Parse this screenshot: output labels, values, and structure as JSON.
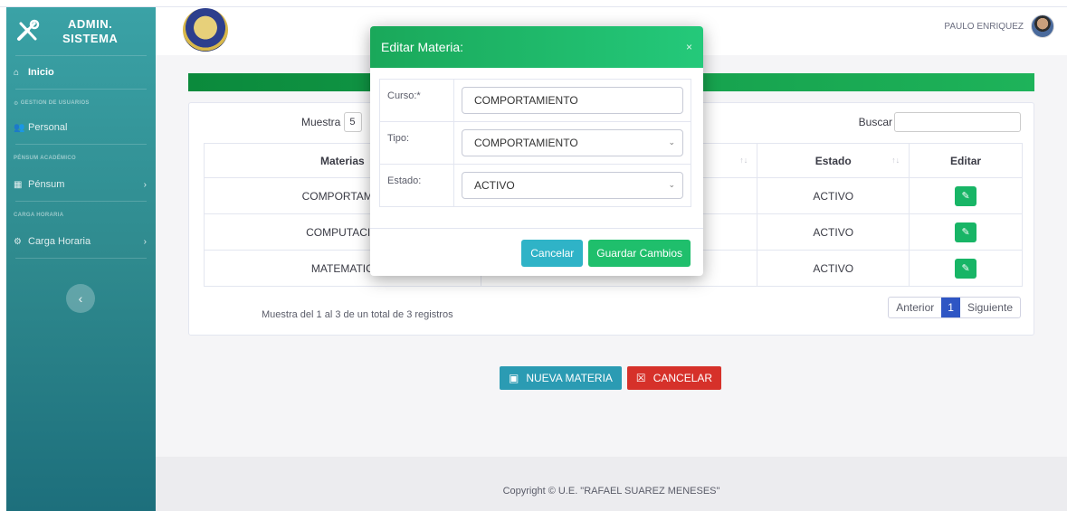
{
  "sidebar": {
    "brand_line1": "ADMIN.",
    "brand_line2": "SISTEMA",
    "brand_icon": "tools-icon",
    "inicio": "Inicio",
    "heading_users": "GESTION DE USUARIOS",
    "personal": "Personal",
    "heading_pensum": "PÉNSUM ACADÉMICO",
    "pensum": "Pénsum",
    "heading_carga": "CARGA HORARIA",
    "carga": "Carga Horaria",
    "toggle_icon": "‹"
  },
  "header": {
    "user_name": "PAULO ENRIQUEZ"
  },
  "table": {
    "show_label": "Muestra",
    "show_value": "5",
    "search_label": "Buscar",
    "columns": [
      "Materias",
      "",
      "Estado",
      "Editar"
    ],
    "rows": [
      {
        "materia": "COMPORTAMIE",
        "estado": "ACTIVO"
      },
      {
        "materia": "COMPUTACIO",
        "estado": "ACTIVO"
      },
      {
        "materia": "MATEMATIC",
        "estado": "ACTIVO"
      }
    ],
    "info": "Muestra del 1 al 3 de un total de 3 registros",
    "pager_prev": "Anterior",
    "pager_current": "1",
    "pager_next": "Siguiente"
  },
  "actions": {
    "nueva": "NUEVA MATERIA",
    "cancelar": "CANCELAR"
  },
  "footer": {
    "text": "Copyright © U.E. \"RAFAEL SUAREZ MENESES\""
  },
  "modal": {
    "title": "Editar Materia:",
    "close": "×",
    "curso_label": "Curso:*",
    "curso_value": "COMPORTAMIENTO",
    "tipo_label": "Tipo:",
    "tipo_value": "COMPORTAMIENTO",
    "estado_label": "Estado:",
    "estado_value": "ACTIVO",
    "cancel_label": "Cancelar",
    "save_label": "Guardar Cambios"
  }
}
